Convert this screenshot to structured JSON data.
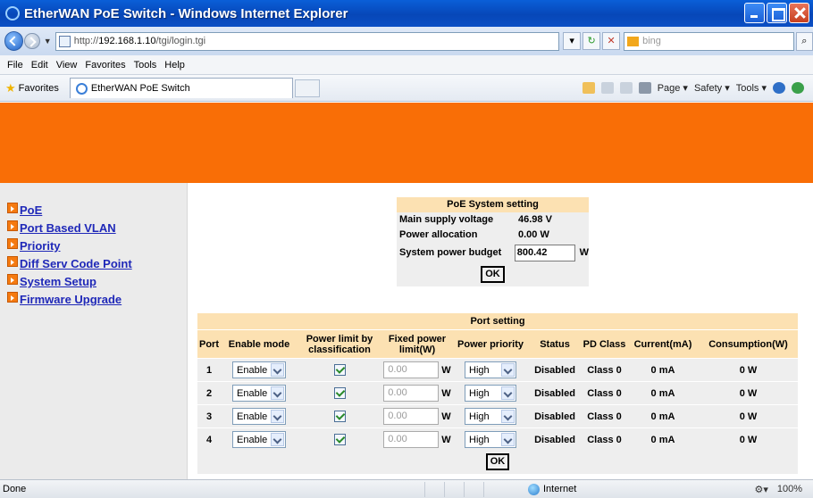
{
  "window": {
    "title": "EtherWAN PoE Switch - Windows Internet Explorer"
  },
  "address": {
    "url_prefix": "http://",
    "url_host": "192.168.1.10",
    "url_path": "/tgi/login.tgi",
    "search_placeholder": "bing"
  },
  "menu": [
    "File",
    "Edit",
    "View",
    "Favorites",
    "Tools",
    "Help"
  ],
  "favorites": {
    "label": "Favorites",
    "tab_title": "EtherWAN PoE Switch"
  },
  "commandbar": {
    "page": "Page ▾",
    "safety": "Safety ▾",
    "tools": "Tools ▾",
    "help": "❷▾"
  },
  "sidebar": {
    "items": [
      {
        "label": "PoE"
      },
      {
        "label": "Port Based VLAN"
      },
      {
        "label": "Priority"
      },
      {
        "label": "Diff Serv Code Point"
      },
      {
        "label": "System Setup"
      },
      {
        "label": "Firmware Upgrade"
      }
    ]
  },
  "poe_system": {
    "title": "PoE System setting",
    "main_supply_label": "Main supply voltage",
    "main_supply_value": "46.98 V",
    "power_alloc_label": "Power allocation",
    "power_alloc_value": "0.00 W",
    "budget_label": "System power budget",
    "budget_value": "800.42",
    "budget_unit": "W",
    "ok": "OK"
  },
  "port_setting": {
    "title": "Port setting",
    "headers": [
      "Port",
      "Enable mode",
      "Power limit by classification",
      "Fixed power limit(W)",
      "Power priority",
      "Status",
      "PD Class",
      "Current(mA)",
      "Consumption(W)"
    ],
    "rows": [
      {
        "port": "1",
        "enable": "Enable",
        "classification": true,
        "fixed": "0.00",
        "unit": "W",
        "priority": "High",
        "status": "Disabled",
        "pd_class": "Class 0",
        "current": "0 mA",
        "consumption": "0 W"
      },
      {
        "port": "2",
        "enable": "Enable",
        "classification": true,
        "fixed": "0.00",
        "unit": "W",
        "priority": "High",
        "status": "Disabled",
        "pd_class": "Class 0",
        "current": "0 mA",
        "consumption": "0 W"
      },
      {
        "port": "3",
        "enable": "Enable",
        "classification": true,
        "fixed": "0.00",
        "unit": "W",
        "priority": "High",
        "status": "Disabled",
        "pd_class": "Class 0",
        "current": "0 mA",
        "consumption": "0 W"
      },
      {
        "port": "4",
        "enable": "Enable",
        "classification": true,
        "fixed": "0.00",
        "unit": "W",
        "priority": "High",
        "status": "Disabled",
        "pd_class": "Class 0",
        "current": "0 mA",
        "consumption": "0 W"
      }
    ],
    "ok": "OK"
  },
  "statusbar": {
    "status": "Done",
    "zone": "Internet",
    "zoom": "100%"
  },
  "colors": {
    "banner": "#f96e06",
    "header_bg": "#fce1b2",
    "panel_bg": "#eeeeee",
    "link": "#1f28b8"
  }
}
